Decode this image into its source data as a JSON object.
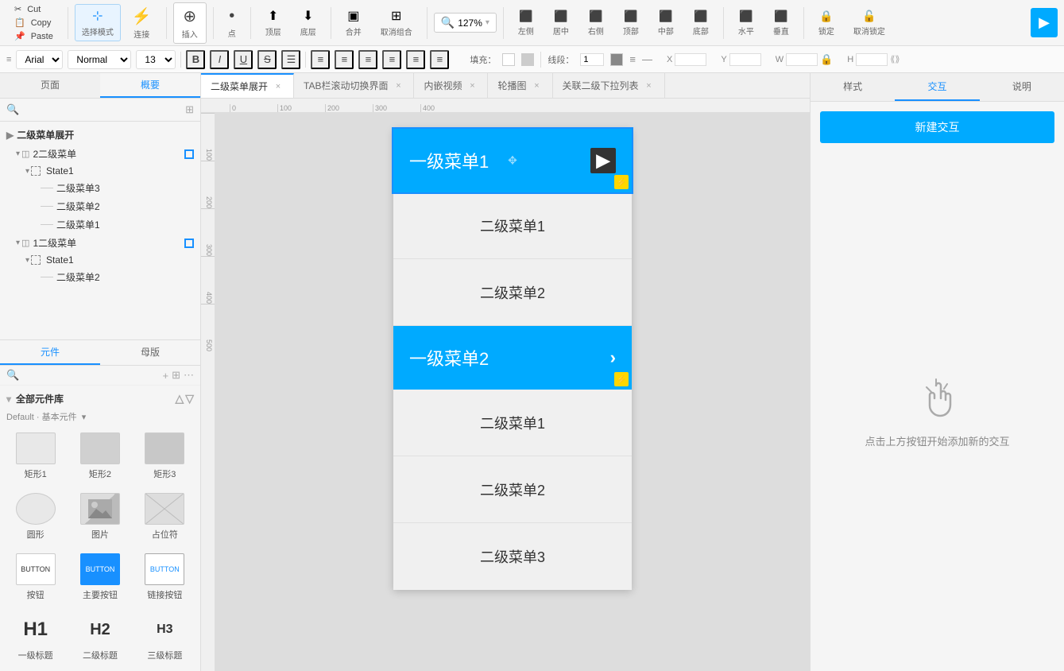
{
  "topToolbar": {
    "cut": "Cut",
    "copy": "Copy",
    "paste": "Paste",
    "selectMode": "选择模式",
    "link": "连接",
    "insert": "插入",
    "point": "点",
    "pageUp": "顶层",
    "pageDown": "底层",
    "group": "合并",
    "ungroup": "取消组合",
    "zoom": "127%",
    "left": "左侧",
    "center": "居中",
    "right": "右侧",
    "top": "顶部",
    "middle": "中部",
    "bottom": "底部",
    "horizontal": "水平",
    "vertical": "垂直",
    "lock": "锁定",
    "unlock": "取消锁定",
    "preview": "预览"
  },
  "formatToolbar": {
    "fontFamily": "Arial",
    "fontStyle": "Normal",
    "fontSize": "13",
    "fill": "填充：",
    "line": "线段：",
    "x": "X",
    "y": "Y",
    "w": "W",
    "h": "H"
  },
  "canvasTabs": [
    {
      "label": "二级菜单展开",
      "active": true
    },
    {
      "label": "TAB栏滚动切换界面",
      "active": false
    },
    {
      "label": "内嵌视频",
      "active": false
    },
    {
      "label": "轮播图",
      "active": false
    },
    {
      "label": "关联二级下拉列表",
      "active": false
    }
  ],
  "leftPanel": {
    "tabs": [
      "概要",
      "页面"
    ],
    "activeTab": "概要",
    "search": {
      "placeholder": "搜索"
    },
    "layers": {
      "sectionTitle": "二级菜单展开",
      "items": [
        {
          "label": "2二级菜单",
          "level": 1,
          "type": "group",
          "hasBadge": true,
          "expanded": true
        },
        {
          "label": "State1",
          "level": 2,
          "type": "state",
          "expanded": true
        },
        {
          "label": "二级菜单3",
          "level": 3,
          "type": "item"
        },
        {
          "label": "二级菜单2",
          "level": 3,
          "type": "item"
        },
        {
          "label": "二级菜单1",
          "level": 3,
          "type": "item"
        },
        {
          "label": "1二级菜单",
          "level": 1,
          "type": "group",
          "hasBadge": true,
          "expanded": true
        },
        {
          "label": "State1",
          "level": 2,
          "type": "state",
          "expanded": true
        },
        {
          "label": "二级菜单2",
          "level": 3,
          "type": "item"
        }
      ]
    },
    "componentTabs": [
      "元件",
      "母版"
    ],
    "activeComponentTab": "元件",
    "libraryTitle": "全部元件库",
    "source": "Default · 基本元件",
    "components": [
      {
        "label": "矩形1",
        "type": "rect1"
      },
      {
        "label": "矩形2",
        "type": "rect2"
      },
      {
        "label": "矩形3",
        "type": "rect3"
      },
      {
        "label": "圆形",
        "type": "circle"
      },
      {
        "label": "图片",
        "type": "img"
      },
      {
        "label": "占位符",
        "type": "placeholder"
      },
      {
        "label": "按钮",
        "type": "btn-normal",
        "text": "BUTTON"
      },
      {
        "label": "主要按钮",
        "type": "btn-primary",
        "text": "BUTTON"
      },
      {
        "label": "链接按钮",
        "type": "btn-link",
        "text": "BUTTON"
      },
      {
        "label": "一级标题",
        "type": "h1",
        "text": "H1"
      },
      {
        "label": "二级标题",
        "type": "h2",
        "text": "H2"
      },
      {
        "label": "三级标题",
        "type": "h3",
        "text": "H3"
      }
    ]
  },
  "canvas": {
    "menu1": {
      "title": "一级菜单1",
      "subItems": [
        "二级菜单1",
        "二级菜单2"
      ],
      "expanded": true
    },
    "menu2": {
      "title": "一级菜单2",
      "subItems": [
        "二级菜单1",
        "二级菜单2",
        "二级菜单3"
      ],
      "expanded": true
    }
  },
  "rightPanel": {
    "tabs": [
      "样式",
      "交互",
      "说明"
    ],
    "activeTab": "交互",
    "newInteractionLabel": "新建交互",
    "emptyHint": "点击上方按钮开始添加新的交互"
  },
  "rulers": {
    "topMarks": [
      "0",
      "100",
      "200",
      "300",
      "400"
    ],
    "leftMarks": [
      "100",
      "200",
      "300",
      "400",
      "500"
    ]
  }
}
